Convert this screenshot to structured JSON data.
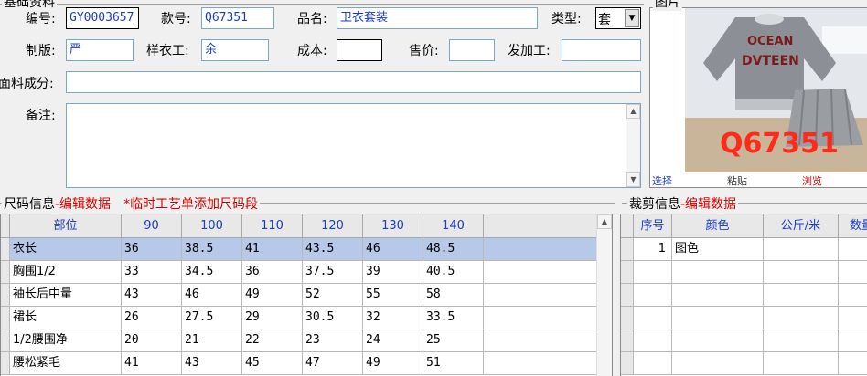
{
  "basic": {
    "group_title": "基础资料",
    "code_label": "编号:",
    "code_value": "GY0003657",
    "style_label": "款号:",
    "style_value": "Q67351",
    "name_label": "品名:",
    "name_value": "卫衣套装",
    "type_label": "类型:",
    "type_value": "套",
    "pattern_label": "制版:",
    "pattern_value": "严",
    "sample_label": "样衣工:",
    "sample_value": "余",
    "cost_label": "成本:",
    "cost_value": "",
    "price_label": "售价:",
    "price_value": "",
    "outsource_label": "发加工:",
    "outsource_value": "",
    "fabric_label": "面料成分:",
    "fabric_value": "",
    "note_label": "备注:",
    "note_value": ""
  },
  "image_panel": {
    "title": "图片",
    "photo_overlay": "Q67351",
    "shirt_text_1": "OCEAN",
    "shirt_text_2": "DVTEEN",
    "choose": "选择",
    "paste": "粘贴",
    "browse": "浏览"
  },
  "size_section": {
    "title": "尺码信息",
    "edit_link": "-编辑数据",
    "tip": "*临时工艺单添加尺码段",
    "headers": [
      "部位",
      "90",
      "100",
      "110",
      "120",
      "130",
      "140"
    ],
    "rows": [
      [
        "衣长",
        "36",
        "38.5",
        "41",
        "43.5",
        "46",
        "48.5"
      ],
      [
        "胸围1/2",
        "33",
        "34.5",
        "36",
        "37.5",
        "39",
        "40.5"
      ],
      [
        "袖长后中量",
        "43",
        "46",
        "49",
        "52",
        "55",
        "58"
      ],
      [
        "裙长",
        "26",
        "27.5",
        "29",
        "30.5",
        "32",
        "33.5"
      ],
      [
        "1/2腰围净",
        "20",
        "21",
        "22",
        "23",
        "24",
        "25"
      ],
      [
        "腰松紧毛",
        "41",
        "43",
        "45",
        "47",
        "49",
        "51"
      ]
    ]
  },
  "cut_section": {
    "title": "裁剪信息",
    "edit_link": "-编辑数据",
    "headers": [
      "序号",
      "颜色",
      "公斤/米",
      "数量"
    ],
    "rows": [
      [
        "1",
        "图色",
        "",
        ""
      ]
    ]
  },
  "colors": {
    "selected_row": "#b7c9e8",
    "header_text": "#1a3cc8",
    "accent_red": "#d40000"
  }
}
